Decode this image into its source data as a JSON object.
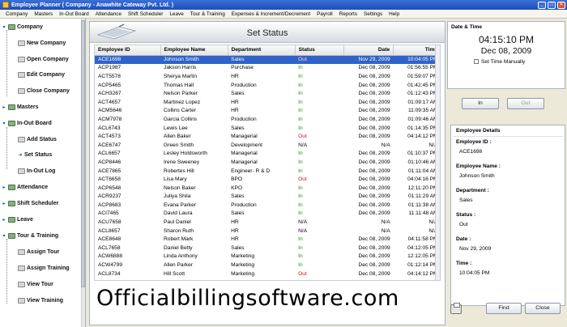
{
  "window": {
    "title": "Employee Planner ( Company - Anawhite Cateway Pvt. Ltd. )",
    "min": "_",
    "max": "□",
    "close": "✕"
  },
  "menu": [
    "Company",
    "Masters",
    "In-Out Board",
    "Attendance",
    "Shift Scheduler",
    "Leave",
    "Tour & Training",
    "Expenses & Increment/Decrement",
    "Payroll",
    "Reports",
    "Settings",
    "Help"
  ],
  "sidebar": {
    "company": "Company",
    "new_company": "New Company",
    "open_company": "Open Company",
    "edit_company": "Edit Company",
    "close_company": "Close Company",
    "masters": "Masters",
    "inout_board": "In-Out Board",
    "add_status": "Add Status",
    "set_status": "Set Status",
    "inout_log": "In-Out Log",
    "attendance": "Attendance",
    "shift_scheduler": "Shift Scheduler",
    "leave": "Leave",
    "tour_training": "Tour & Training",
    "assign_tour": "Assign Tour",
    "assign_training": "Assign Training",
    "view_tour": "View Tour",
    "view_training": "View Training"
  },
  "main": {
    "title": "Set Status",
    "columns": [
      "Employee ID",
      "Employee Name",
      "Department",
      "Status",
      "Date",
      "Time"
    ],
    "rows": [
      [
        "ACE1698",
        "Johnson Smith",
        "Sales",
        "Out",
        "Nov 29, 2009",
        "10:04:05 PM"
      ],
      [
        "ACP1987",
        "Jakson Harris",
        "Purchase",
        "In",
        "Dec 08, 2009",
        "01:56:55 PM"
      ],
      [
        "ACT5578",
        "Sherya Martin",
        "HR",
        "In",
        "Dec 08, 2009",
        "01:59:07 PM"
      ],
      [
        "ACP5465",
        "Thomas Hall",
        "Production",
        "In",
        "Dec 08, 2009",
        "01:42:45 PM"
      ],
      [
        "ACH3267",
        "Nelson Parker",
        "Sales",
        "In",
        "Dec 08, 2009",
        "01:12:43 PM"
      ],
      [
        "ACT4657",
        "Martinez Lopez",
        "HR",
        "In",
        "Dec 08, 2009",
        "01:09:17 AM"
      ],
      [
        "ACM5646",
        "Collins Carter",
        "HR",
        "In",
        "Dec 08, 2009",
        "11:09:35 AM"
      ],
      [
        "ACM7978",
        "Garcia Collins",
        "Production",
        "In",
        "Dec 08, 2009",
        "01:09:46 AM"
      ],
      [
        "ACL6743",
        "Lewis Lee",
        "Sales",
        "In",
        "Dec 08, 2009",
        "01:14:35 PM"
      ],
      [
        "ACT4573",
        "Allen Baker",
        "Managerial",
        "Out",
        "Dec 08, 2009",
        "04:14:12 PM"
      ],
      [
        "ACE6747",
        "Green Smith",
        "Development",
        "N/A",
        "N/A",
        "N/A"
      ],
      [
        "ACL6657",
        "Lesley Holdsworth",
        "Managerial",
        "In",
        "Dec 08, 2009",
        "01:10:37 PM"
      ],
      [
        "ACP8446",
        "Irene Sweeney",
        "Managerial",
        "In",
        "Dec 08, 2009",
        "01:10:46 AM"
      ],
      [
        "ACE7865",
        "Robertes Hill",
        "Engineer- R & D",
        "In",
        "Dec 08, 2009",
        "01:11:04 AM"
      ],
      [
        "ACT6658",
        "Lisa Mary",
        "BPO",
        "Out",
        "Dec 08, 2009",
        "04:04:16 PM"
      ],
      [
        "ACP6548",
        "Nelson Baker",
        "KPO",
        "In",
        "Dec 08, 2009",
        "12:11:20 PM"
      ],
      [
        "ACR9237",
        "Juliya Shila",
        "Sales",
        "In",
        "Dec 08, 2009",
        "01:11:29 AM"
      ],
      [
        "ACP8683",
        "Evana Parker",
        "Production",
        "In",
        "Dec 08, 2009",
        "01:11:38 AM"
      ],
      [
        "ACI7465",
        "David Laura",
        "Sales",
        "In",
        "Dec 08, 2009",
        "11:11:48 AM"
      ],
      [
        "ACU7658",
        "Paul Daniel",
        "HR",
        "N/A",
        "N/A",
        "N/A"
      ],
      [
        "ACL8657",
        "Sharon Ruth",
        "HR",
        "N/A",
        "N/A",
        "N/A"
      ],
      [
        "ACE8648",
        "Robert Mark",
        "HR",
        "In",
        "Dec 08, 2009",
        "04:11:58 PM"
      ],
      [
        "ACL7658",
        "Daniel Betty",
        "Sales",
        "In",
        "Dec 08, 2009",
        "04:12:05 PM"
      ],
      [
        "ACW6888",
        "Linda Anthony",
        "Marketing",
        "In",
        "Dec 08, 2009",
        "12:12:05 PM"
      ],
      [
        "ACW4799",
        "Allen Parker",
        "Marketing",
        "In",
        "Dec 08, 2009",
        "01:12:14 PM"
      ],
      [
        "ACL8734",
        "Hill Scott",
        "Marketing",
        "Out",
        "Dec 08, 2009",
        "04:14:12 PM"
      ]
    ]
  },
  "watermark": "Officialbillingsoftware.com",
  "datetime": {
    "label": "Date & Time",
    "time": "04:15:10 PM",
    "date": "Dec 08, 2009",
    "set_manually": "Set Time Manually"
  },
  "buttons": {
    "in": "In",
    "out": "Out",
    "find": "Find",
    "close": "Close"
  },
  "details": {
    "heading": "Employee Details",
    "id_label": "Employee ID :",
    "id": "ACE1698",
    "name_label": "Employee Name :",
    "name": "Johnson Smith",
    "dept_label": "Department :",
    "dept": "Sales",
    "status_label": "Status :",
    "status": "Out",
    "date_label": "Date :",
    "date": "Nov 29, 2009",
    "time_label": "Time :",
    "time": "10:04:05 PM"
  }
}
